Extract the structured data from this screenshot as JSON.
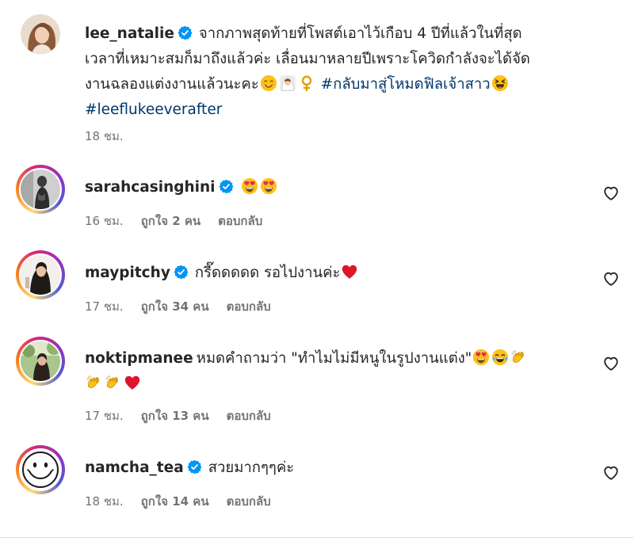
{
  "post": {
    "username": "lee_natalie",
    "caption_line1": "จากภาพสุดท้ายที่โพสต์เอาไว้เกือบ 4 ปีที่แล้วในที่สุด",
    "caption_line2": "เวลาที่เหมาะสมก็มาถึงแล้วค่ะ เลื่อนมาหลายปีเพราะโควิดกำลังจะได้จัด",
    "caption_line3": "งานฉลองแต่งงานแล้วนะคะ",
    "hashtag1": "#กลับมาสู่โหมดฟิลเจ้าสาว",
    "hashtag2": "#leeflukeeverafter",
    "time": "18 ชม."
  },
  "comments": [
    {
      "username": "sarahcasinghini",
      "text": "",
      "time": "16 ชม.",
      "likes": "ถูกใจ 2 คน",
      "reply": "ตอบกลับ"
    },
    {
      "username": "maypitchy",
      "text": "กรี๊ดดดดด รอไปงานค่ะ",
      "time": "17 ชม.",
      "likes": "ถูกใจ 34 คน",
      "reply": "ตอบกลับ"
    },
    {
      "username": "noktipmanee",
      "text": "หมดคำถามว่า \"ทำไมไม่มีหนูในรูปงานแต่ง\"",
      "time": "17 ชม.",
      "likes": "ถูกใจ 13 คน",
      "reply": "ตอบกลับ"
    },
    {
      "username": "namcha_tea",
      "text": "สวยมากๆๆค่ะ",
      "time": "18 ชม.",
      "likes": "ถูกใจ 14 คน",
      "reply": "ตอบกลับ"
    }
  ],
  "icons": {
    "verified": "verified-badge-icon",
    "like": "heart-outline-icon"
  },
  "colors": {
    "verified": "#0095f6",
    "hashtag": "#00376b",
    "meta": "#737373"
  }
}
